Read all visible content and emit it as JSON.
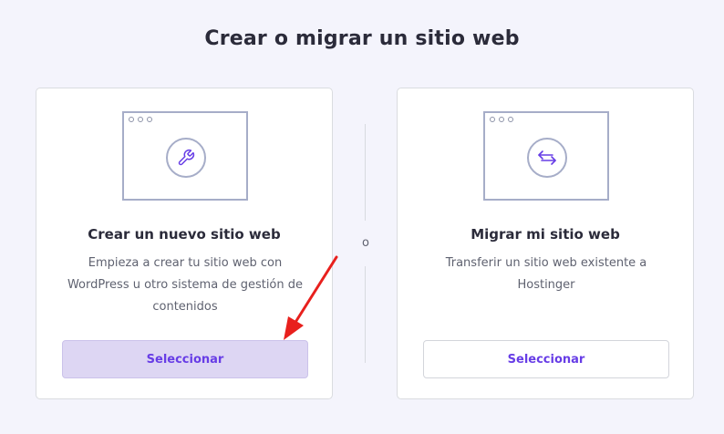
{
  "page": {
    "title": "Crear o migrar un sitio web"
  },
  "divider": {
    "label": "o"
  },
  "options": [
    {
      "title": "Crear un nuevo sitio web",
      "description": "Empieza a crear tu sitio web con WordPress u otro sistema de gestión de contenidos",
      "button_label": "Seleccionar",
      "icon": "wrench-icon",
      "highlighted": true
    },
    {
      "title": "Migrar mi sitio web",
      "description": "Transferir un sitio web existente a Hostinger",
      "button_label": "Seleccionar",
      "icon": "transfer-arrows-icon",
      "highlighted": false
    }
  ],
  "colors": {
    "accent": "#673de6",
    "highlight_button_bg": "#ddd6f3",
    "annotation_arrow": "#e8201d",
    "page_bg": "#f4f4fc"
  }
}
